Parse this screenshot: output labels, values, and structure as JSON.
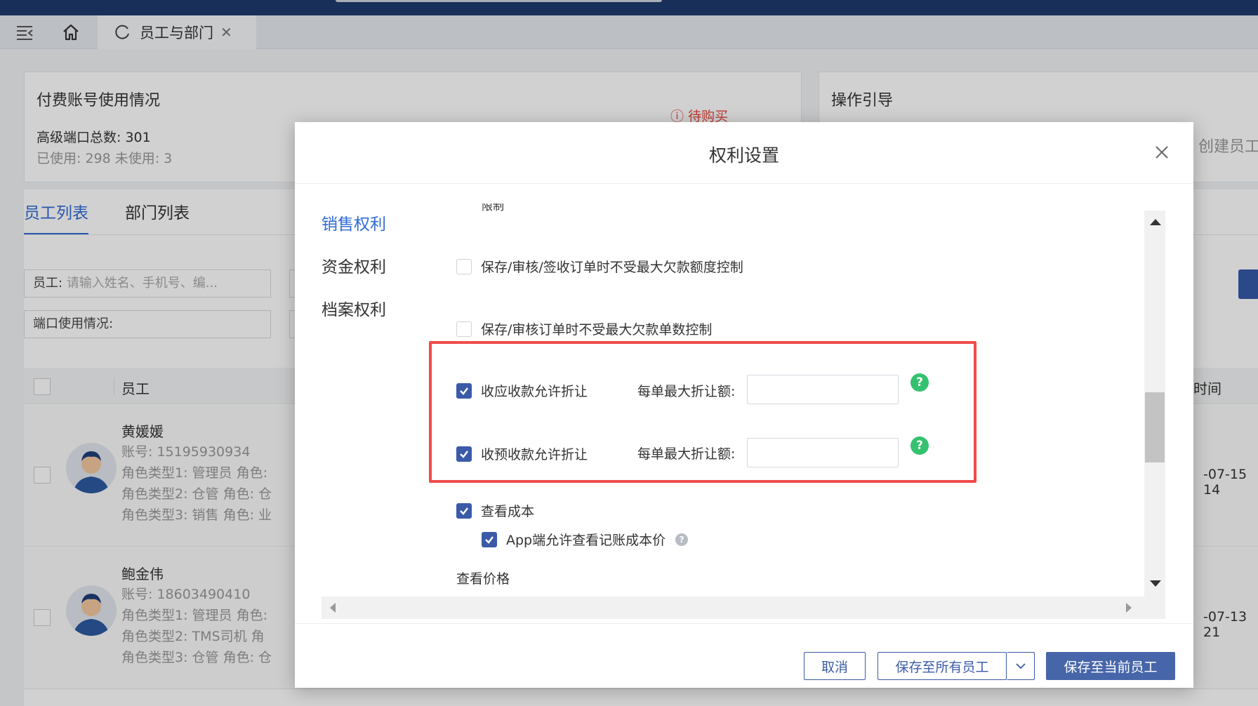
{
  "tabbar": {
    "tab_label": "员工与部门",
    "tab_close": "✕"
  },
  "usage_card": {
    "title": "付费账号使用情况",
    "total_label": "高级端口总数: 301",
    "used_label": "已使用: 298   未使用: 3",
    "pending_label": "待购买"
  },
  "guide_card": {
    "title": "操作引导",
    "create_label": "创建员工"
  },
  "list": {
    "tabs": [
      "员工列表",
      "部门列表"
    ],
    "filter_emp_label": "员工:",
    "filter_emp_placeholder": "请输入姓名、手机号、编...",
    "filter_port_label": "端口使用情况:",
    "col_employee": "员工",
    "col_time": "时间",
    "rows": [
      {
        "name": "黄媛媛",
        "account": "账号: 15195930934",
        "role1": "角色类型1: 管理员      角色:",
        "role2": "角色类型2: 仓管      角色: 仓",
        "role3": "角色类型3: 销售      角色: 业",
        "time": "-07-15 14"
      },
      {
        "name": "鲍金伟",
        "account": "账号: 18603490410",
        "role1": "角色类型1: 管理员      角色:",
        "role2": "角色类型2: TMS司机      角",
        "role3": "角色类型3: 仓管      角色: 仓",
        "time": "-07-13 21"
      }
    ]
  },
  "modal": {
    "title": "权利设置",
    "nav": [
      "销售权利",
      "资金权利",
      "档案权利"
    ],
    "cut_text": "限制",
    "perms": {
      "p1": "保存/审核/签收订单时不受最大欠款额度控制",
      "p2": "保存/审核订单时不受最大欠款单数控制",
      "p3": "收应收款允许折让",
      "p4": "收预收款允许折让",
      "p5": "查看成本",
      "p6": "App端允许查看记账成本价"
    },
    "checked": {
      "p1": false,
      "p2": false,
      "p3": true,
      "p4": true,
      "p5": true,
      "p6": true
    },
    "discount_label": "每单最大折让额:",
    "discount_value_1": "",
    "discount_value_2": "",
    "help_mark": "?",
    "section_price": "查看价格",
    "buttons": {
      "cancel": "取消",
      "save_all": "保存至所有员工",
      "save_current": "保存至当前员工"
    }
  },
  "colors": {
    "accent": "#2f6bd6",
    "primary_button": "#4766a9",
    "highlight_border": "#ef4b4b",
    "help_green": "#34c26f",
    "pending_red": "#e8463c"
  }
}
